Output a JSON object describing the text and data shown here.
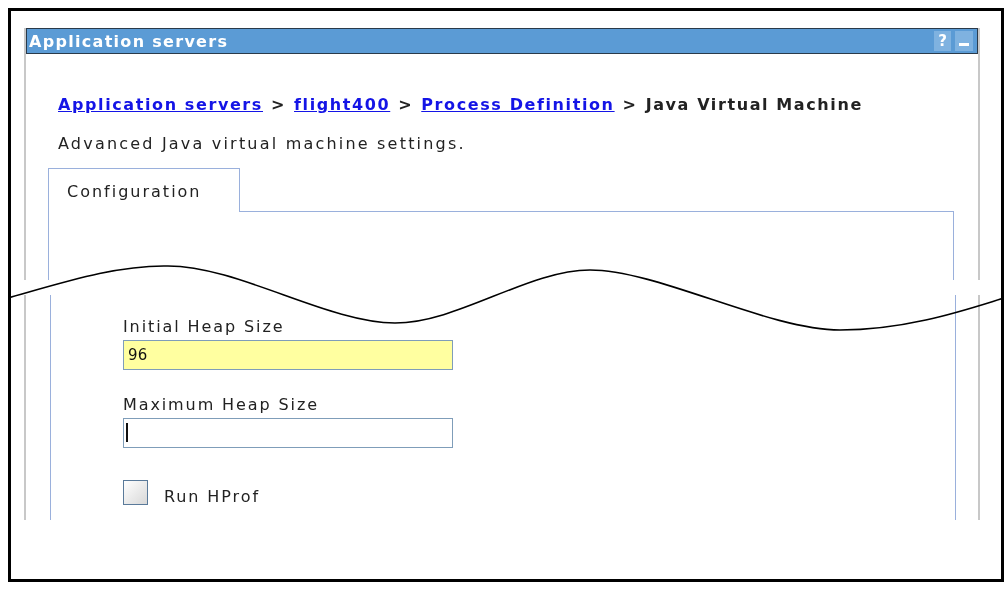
{
  "panel": {
    "title": "Application servers",
    "help": "?"
  },
  "breadcrumb": [
    {
      "kind": "link",
      "label": "Application servers"
    },
    {
      "kind": "separator",
      "label": ">"
    },
    {
      "kind": "link",
      "label": "flight400"
    },
    {
      "kind": "separator",
      "label": ">"
    },
    {
      "kind": "link",
      "label": "Process Definition"
    },
    {
      "kind": "separator",
      "label": ">"
    },
    {
      "kind": "current",
      "label": "Java Virtual Machine"
    }
  ],
  "description": "Advanced Java virtual machine settings.",
  "tabs": [
    {
      "label": "Configuration",
      "selected": true
    }
  ],
  "fields": [
    {
      "kind": "text",
      "label": "Initial Heap Size",
      "value": "96",
      "highlighted": true,
      "focused": false
    },
    {
      "kind": "text",
      "label": "Maximum Heap Size",
      "highlighted": false,
      "focused": true
    },
    {
      "kind": "checkbox",
      "label": "Run HProf",
      "checked": false
    }
  ]
}
